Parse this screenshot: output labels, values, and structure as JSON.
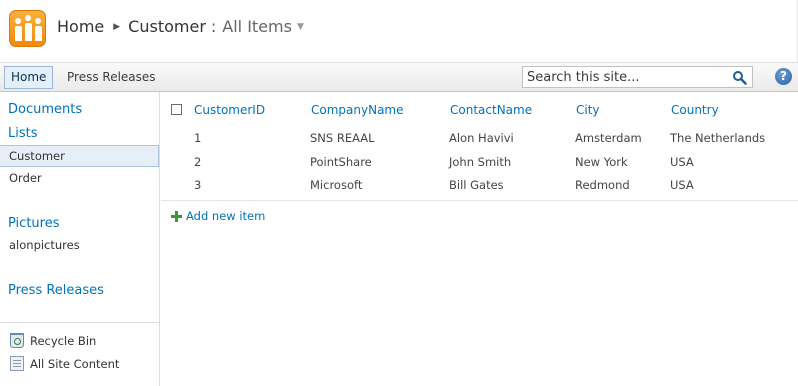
{
  "breadcrumb": {
    "site": "Home",
    "list": "Customer",
    "separator": ":",
    "view": "All Items"
  },
  "topnav": {
    "tabs": [
      {
        "label": "Home",
        "selected": true
      },
      {
        "label": "Press Releases",
        "selected": false
      }
    ],
    "search_placeholder": "Search this site...",
    "help_label": "?"
  },
  "leftnav": {
    "documents": "Documents",
    "lists": "Lists",
    "list_items": [
      {
        "label": "Customer",
        "selected": true
      },
      {
        "label": "Order",
        "selected": false
      }
    ],
    "pictures": "Pictures",
    "picture_items": [
      {
        "label": "alonpictures"
      }
    ],
    "press_releases": "Press Releases",
    "recycle_bin": "Recycle Bin",
    "all_site_content": "All Site Content"
  },
  "list": {
    "columns": [
      "CustomerID",
      "CompanyName",
      "ContactName",
      "City",
      "Country"
    ],
    "rows": [
      [
        "1",
        "SNS REAAL",
        "Alon Havivi",
        "Amsterdam",
        "The Netherlands"
      ],
      [
        "2",
        "PointShare",
        "John Smith",
        "New York",
        "USA"
      ],
      [
        "3",
        "Microsoft",
        "Bill Gates",
        "Redmond",
        "USA"
      ]
    ],
    "add_new_item": "Add new item"
  },
  "colors": {
    "link_blue": "#0072bc",
    "selected_bg": "#e6eef7",
    "logo_orange": "#f39c1f"
  }
}
